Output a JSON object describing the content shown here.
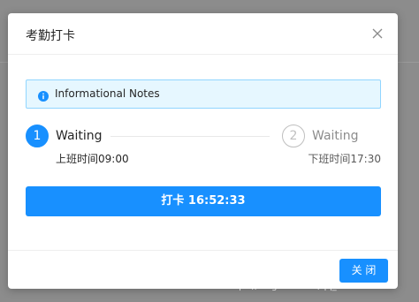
{
  "modal": {
    "title": "考勤打卡",
    "close_icon": "close-icon"
  },
  "alert": {
    "icon": "info-icon",
    "text": "Informational Notes",
    "accent": "#1890ff"
  },
  "steps": [
    {
      "number": "1",
      "title": "Waiting",
      "description": "上班时间09:00",
      "status": "active"
    },
    {
      "number": "2",
      "title": "Waiting",
      "description": "下班时间17:30",
      "status": "waiting"
    }
  ],
  "punch_button": {
    "label": "打卡 16:52:33"
  },
  "footer": {
    "close_label": "关 闭"
  },
  "watermark": {
    "text": "https://blog.csdn.net/qq_40516557"
  },
  "colors": {
    "primary": "#1890ff",
    "alert_bg": "#e6f7ff",
    "alert_border": "#91d5ff"
  }
}
